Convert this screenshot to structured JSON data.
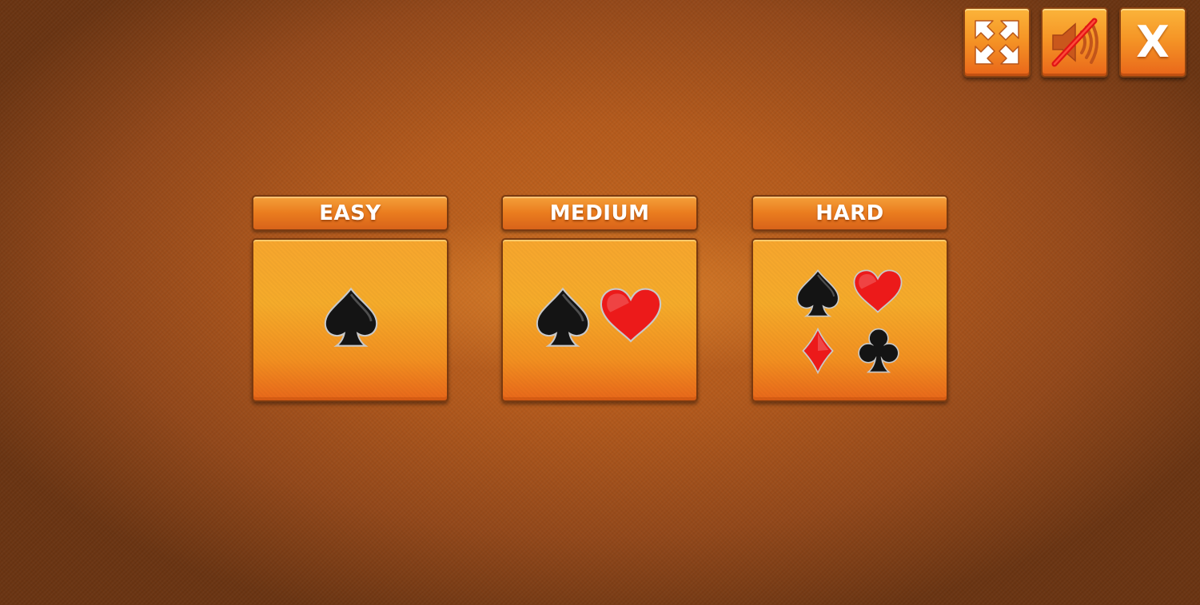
{
  "controls": {
    "fullscreen_icon": "fullscreen-expand-arrows",
    "sound_icon": "speaker-muted",
    "close_label": "X"
  },
  "levels": [
    {
      "id": "easy",
      "label": "EASY",
      "suits": [
        "spade"
      ]
    },
    {
      "id": "medium",
      "label": "MEDIUM",
      "suits": [
        "spade",
        "heart"
      ]
    },
    {
      "id": "hard",
      "label": "HARD",
      "suits": [
        "spade",
        "heart",
        "diamond",
        "club"
      ]
    }
  ],
  "colors": {
    "suit_black": "#111111",
    "suit_red": "#e8141a",
    "panel_orange": "#f5a229",
    "background": "#b45a1c"
  }
}
